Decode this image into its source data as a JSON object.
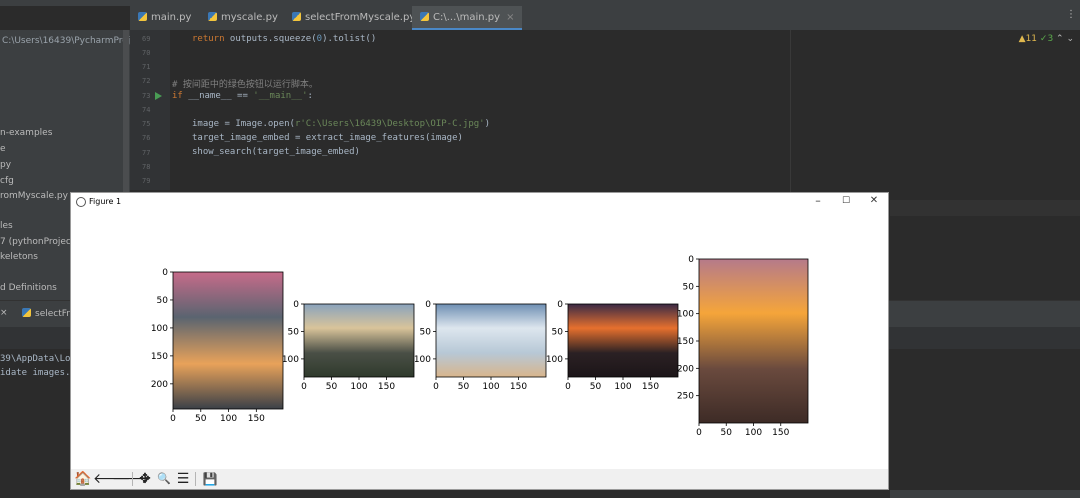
{
  "editor": {
    "tabs": [
      {
        "label": "main.py"
      },
      {
        "label": "myscale.py"
      },
      {
        "label": "selectFromMyscale.py"
      },
      {
        "label": "C:\\...\\main.py"
      }
    ],
    "close_glyph": "×",
    "line_numbers": [
      "69",
      "70",
      "71",
      "72",
      "73",
      "74",
      "75",
      "76",
      "77",
      "78",
      "79"
    ],
    "code": {
      "l69_kw": "return",
      "l69_rest": " outputs.squeeze(",
      "l69_num": "0",
      "l69_end": ").tolist()",
      "l72_comment": "# 按间距中的绿色按钮以运行脚本。",
      "l73_kw": "if",
      "l73_mid": " __name__ == ",
      "l73_str": "'__main__'",
      "l73_end": ":",
      "l75_start": "image = Image.open(",
      "l75_str": "r'C:\\Users\\16439\\Desktop\\OIP-C.jpg'",
      "l75_end": ")",
      "l76": "target_image_embed = extract_image_features(image)",
      "l77": "show_search(target_image_embed)"
    },
    "inspections": {
      "warnings": "11",
      "ok": "3",
      "warn_glyph": "▲",
      "ok_glyph": "✓",
      "nav_glyphs": "⌃ ⌄"
    }
  },
  "project": {
    "path": "C:\\Users\\16439\\PycharmProject",
    "items": [
      "n-examples",
      "e",
      "py",
      "cfg",
      "romMyscale.py",
      "les",
      "7 (pythonProject)",
      "keletons",
      "d Definitions"
    ]
  },
  "run_panel": {
    "close_glyph": "×",
    "tab_label": "selectFro",
    "console_lines": [
      "39\\AppData\\Loc",
      "idate images.."
    ]
  },
  "figure": {
    "title": "Figure 1",
    "window_buttons": {
      "minimize": "–",
      "maximize": "☐",
      "close": "✕"
    },
    "toolbar": {
      "home": "🏠",
      "back": "🡐",
      "forward": "🡒",
      "pan": "✥",
      "zoom": "🔍",
      "configure": "☰",
      "save": "💾"
    }
  },
  "chart_data": [
    {
      "type": "image",
      "title": "",
      "xlabel": "",
      "ylabel": "",
      "xticks": [
        0,
        50,
        100,
        150
      ],
      "yticks": [
        0,
        50,
        100,
        150,
        200
      ],
      "xlim": [
        0,
        198
      ],
      "ylim": [
        245,
        0
      ],
      "colors": [
        "#c66b8a",
        "#5a6470",
        "#e8a25a",
        "#3b4048"
      ]
    },
    {
      "type": "image",
      "title": "",
      "xlabel": "",
      "ylabel": "",
      "xticks": [
        0,
        50,
        100,
        150
      ],
      "yticks": [
        0,
        50,
        100
      ],
      "xlim": [
        0,
        200
      ],
      "ylim": [
        133,
        0
      ],
      "colors": [
        "#8aa3bd",
        "#d9c49a",
        "#4a4f46",
        "#2f3a2c"
      ]
    },
    {
      "type": "image",
      "title": "",
      "xlabel": "",
      "ylabel": "",
      "xticks": [
        0,
        50,
        100,
        150
      ],
      "yticks": [
        0,
        50,
        100
      ],
      "xlim": [
        0,
        200
      ],
      "ylim": [
        133,
        0
      ],
      "colors": [
        "#6e8fb3",
        "#dde6ee",
        "#b7c8d6",
        "#d8b58c"
      ]
    },
    {
      "type": "image",
      "title": "",
      "xlabel": "",
      "ylabel": "",
      "xticks": [
        0,
        50,
        100,
        150
      ],
      "yticks": [
        0,
        50,
        100
      ],
      "xlim": [
        0,
        200
      ],
      "ylim": [
        133,
        0
      ],
      "colors": [
        "#3a2a45",
        "#e6702e",
        "#2b2124",
        "#1c1518"
      ]
    },
    {
      "type": "image",
      "title": "",
      "xlabel": "",
      "ylabel": "",
      "xticks": [
        0,
        50,
        100,
        150
      ],
      "yticks": [
        0,
        50,
        100,
        150,
        200,
        250
      ],
      "xlim": [
        0,
        200
      ],
      "ylim": [
        300,
        0
      ],
      "colors": [
        "#b57a8a",
        "#f5a53a",
        "#6a4a3e",
        "#3d2b26"
      ]
    }
  ]
}
